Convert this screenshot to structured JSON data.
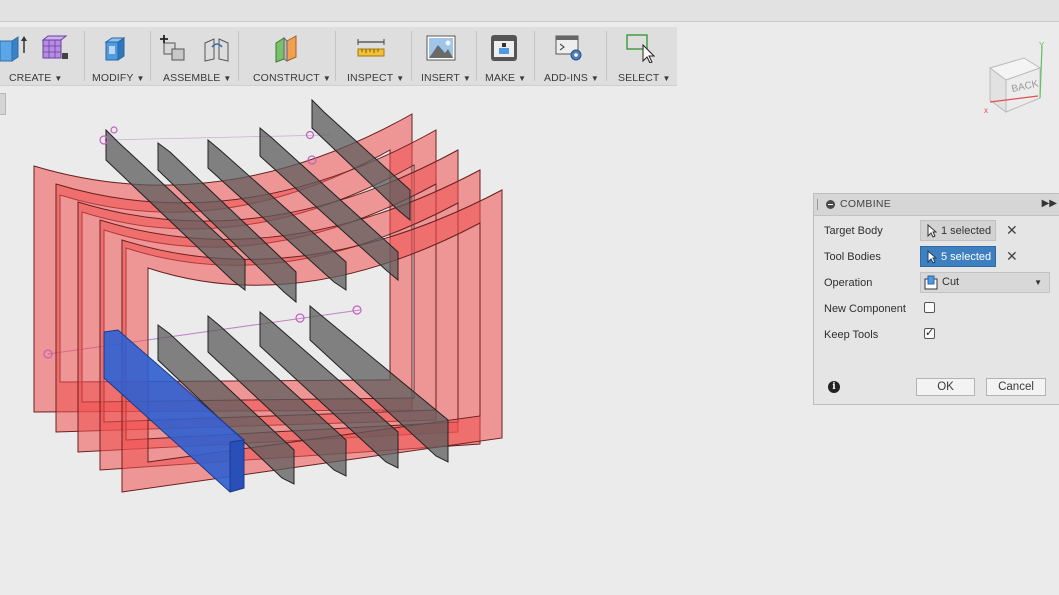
{
  "toolbar": {
    "groups": [
      {
        "label": "CREATE",
        "icon": "extrude-box-icon"
      },
      {
        "label": "MODIFY",
        "icon": "press-pull-icon"
      },
      {
        "label": "ASSEMBLE",
        "icon": "joint-icon"
      },
      {
        "label": "CONSTRUCT",
        "icon": "plane-icon"
      },
      {
        "label": "INSPECT",
        "icon": "measure-ruler-icon"
      },
      {
        "label": "INSERT",
        "icon": "insert-image-icon"
      },
      {
        "label": "MAKE",
        "icon": "3d-print-icon"
      },
      {
        "label": "ADD-INS",
        "icon": "scripts-gear-icon"
      },
      {
        "label": "SELECT",
        "icon": "select-cursor-icon"
      }
    ]
  },
  "viewcube": {
    "face": "BACK"
  },
  "colors": {
    "body_red": "#f05050",
    "tool_blue": "#2f5fd0",
    "tool_gray": "#6a6a6a",
    "selection_blue": "#3d7fbf"
  },
  "dialog": {
    "title": "COMBINE",
    "target_body": {
      "label": "Target Body",
      "value": "1 selected",
      "active": false
    },
    "tool_bodies": {
      "label": "Tool Bodies",
      "value": "5 selected",
      "active": true
    },
    "operation": {
      "label": "Operation",
      "value": "Cut"
    },
    "new_component": {
      "label": "New Component",
      "checked": false
    },
    "keep_tools": {
      "label": "Keep Tools",
      "checked": true
    },
    "ok_label": "OK",
    "cancel_label": "Cancel"
  }
}
